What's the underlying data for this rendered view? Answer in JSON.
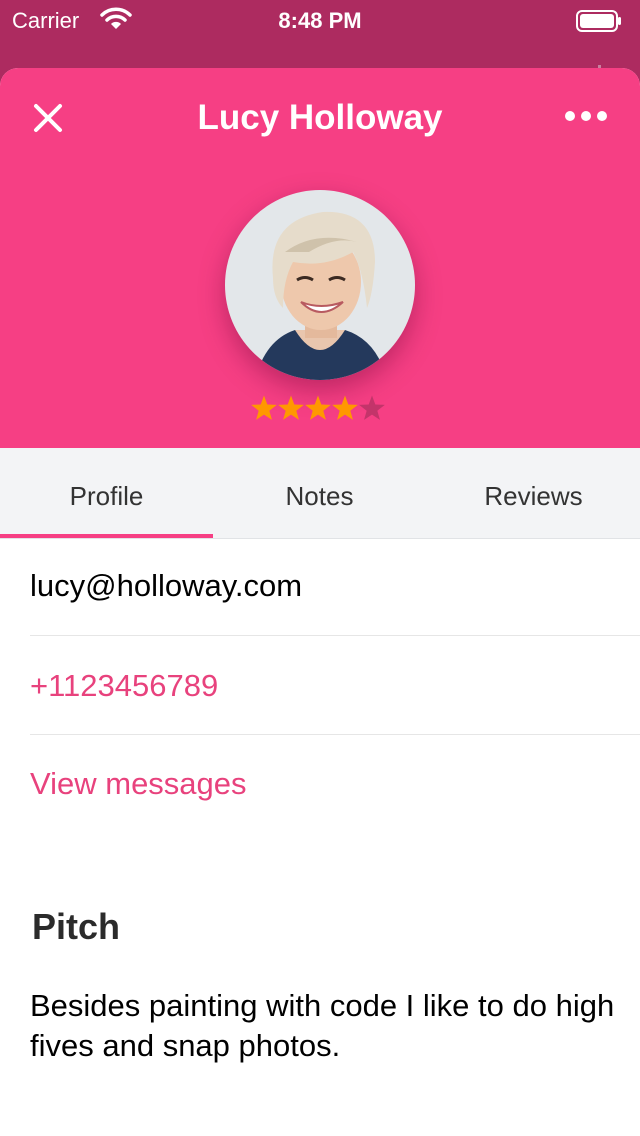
{
  "status_bar": {
    "carrier": "Carrier",
    "time": "8:48 PM"
  },
  "header": {
    "title": "Lucy Holloway",
    "rating": 4,
    "rating_max": 5,
    "accent_color": "#f63f84",
    "star_color": "#ff9800"
  },
  "tabs": [
    {
      "label": "Profile",
      "active": true
    },
    {
      "label": "Notes",
      "active": false
    },
    {
      "label": "Reviews",
      "active": false
    }
  ],
  "contact": {
    "email": "lucy@holloway.com",
    "phone": "+1123456789",
    "messages_link": "View messages"
  },
  "pitch": {
    "heading": "Pitch",
    "text": "Besides painting with code I like to do high fives and snap photos."
  }
}
